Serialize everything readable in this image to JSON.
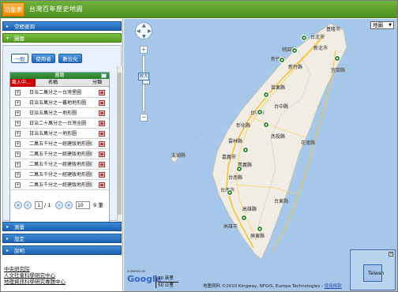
{
  "header": {
    "menu_label": "功能表",
    "site_title": "台灣百年歷史地圖"
  },
  "sidebar": {
    "sections": [
      {
        "label": "空間查詢",
        "arrow": "▸"
      },
      {
        "label": "圖層",
        "arrow": "▾"
      },
      {
        "label": "測量",
        "arrow": "▸"
      },
      {
        "label": "設定",
        "arrow": "▸"
      },
      {
        "label": "說明",
        "arrow": "▸"
      }
    ],
    "layer_tabs": [
      "一般",
      "使用者",
      "數位化"
    ],
    "layer_table": {
      "title": "圖層",
      "col_loading": "載入中...",
      "col_name": "名稱",
      "col_class": "分類",
      "rows": [
        "日治二萬分之一台灣堡圖",
        "日治五萬分之一蕃地地形圖",
        "日治五萬分之一地形圖",
        "日治二十萬分之一台灣全圖",
        "日治五萬分之一地形圖",
        "二萬五千分之一經建版地形圖(",
        "二萬五千分之一經建版地形圖(",
        "二萬五千分之一經建版地形圖(",
        "二萬五千分之一經建版地形圖(",
        "二萬五千分之一經建版地形圖("
      ]
    },
    "pager": {
      "first": "«",
      "prev": "‹",
      "page": "1",
      "of": "/ 1",
      "next": "›",
      "last": "»",
      "per_page": "10",
      "total": "9 筆"
    },
    "footer_links": [
      "中央研究院",
      "人文社會科學研究中心",
      "地理資訊科學研究專題中心"
    ]
  },
  "map": {
    "map_type": "地圖",
    "enlarge_label": "放大",
    "powered_by": "POWERED BY",
    "google": "Google",
    "scale_top": "20 英里",
    "scale_bottom": "50 公里",
    "attribution": "地圖資料 ©2010 Kingway, NFGIS, Europa Technologies -",
    "terms": "使用條款",
    "overview_label": "Taiwan",
    "cities": [
      "基隆市",
      "台北市",
      "新北市",
      "桃園縣",
      "新竹市",
      "新竹縣",
      "宜蘭縣",
      "苗栗縣",
      "台中縣",
      "台中市",
      "彰化縣",
      "南投縣",
      "花蓮縣",
      "雲林縣",
      "嘉義縣",
      "嘉義市",
      "澎湖縣",
      "台南縣",
      "台南市",
      "高雄縣",
      "高雄市",
      "台東縣",
      "屏東縣"
    ]
  },
  "colors": {
    "header_green": "#5a9a2a",
    "menu_orange": "#f7941d",
    "accordion_blue": "#2a72c2",
    "sea": "#a6c7ea",
    "land": "#f1ede4",
    "highway": "#f5c33b"
  }
}
